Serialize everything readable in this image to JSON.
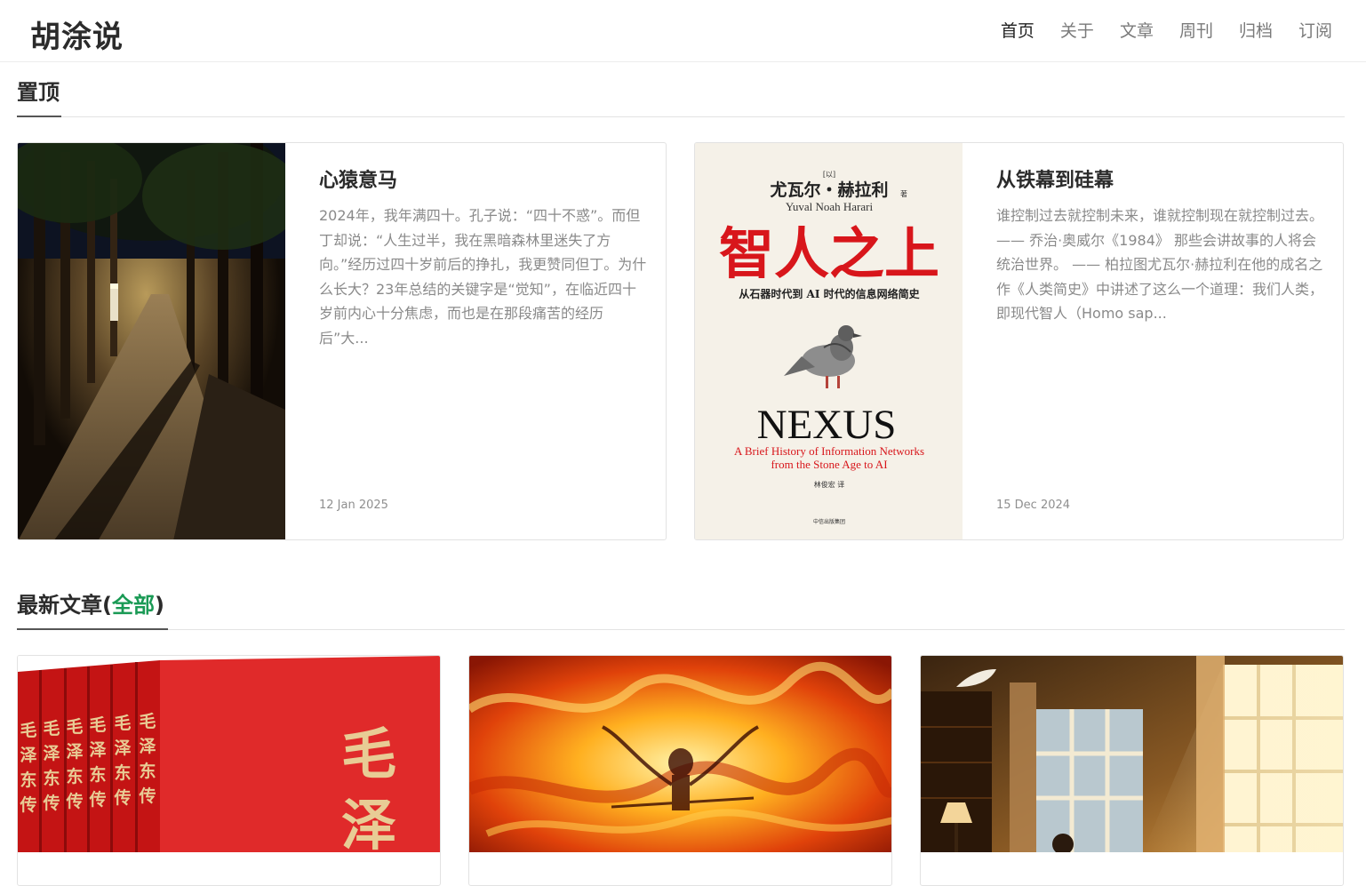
{
  "site": {
    "logo": "胡涂说"
  },
  "nav": {
    "items": [
      {
        "label": "首页",
        "active": true
      },
      {
        "label": "关于",
        "active": false
      },
      {
        "label": "文章",
        "active": false
      },
      {
        "label": "周刊",
        "active": false
      },
      {
        "label": "归档",
        "active": false
      },
      {
        "label": "订阅",
        "active": false
      }
    ]
  },
  "pinned": {
    "title": "置顶",
    "posts": [
      {
        "title": "心猿意马",
        "excerpt": "2024年，我年满四十。孔子说：“四十不惑”。而但丁却说：“人生过半，我在黑暗森林里迷失了方向。”经历过四十岁前后的挣扎，我更赞同但丁。为什么长大？23年总结的关键字是“觉知”，在临近四十岁前内心十分焦虑，而也是在那段痛苦的经历后”大...",
        "date": "12 Jan 2025",
        "image": "night-park-path-photo"
      },
      {
        "title": "从铁幕到硅幕",
        "excerpt": "谁控制过去就控制未来，谁就控制现在就控制过去。 —— 乔治·奥威尔《1984》 那些会讲故事的人将会统治世界。 —— 柏拉图尤瓦尔·赫拉利在他的成名之作《人类简史》中讲述了这么一个道理：我们人类，即现代智人（Homo sap...",
        "date": "15 Dec 2024",
        "image": "nexus-book-cover",
        "cover": {
          "prefix": "[以]",
          "author_cn": "尤瓦尔・赫拉利",
          "author_suffix": "著",
          "author_en": "Yuval Noah Harari",
          "title_cn": "智人之上",
          "subtitle_cn": "从石器时代到 AI 时代的信息网络简史",
          "title_en": "NEXUS",
          "subtitle_en_1": "A Brief History of Information Networks",
          "subtitle_en_2": "from the Stone Age to AI",
          "translator": "林俊宏  译",
          "publisher": "中信出版集团"
        }
      }
    ]
  },
  "latest": {
    "title": "最新文章(",
    "link_label": "全部",
    "title_close": ")",
    "posts": [
      {
        "image": "mao-biography-book-spines",
        "spine_text": "毛泽东传",
        "cover_text": "毛泽"
      },
      {
        "image": "flame-figure-painting"
      },
      {
        "image": "sunlit-window-study-room"
      }
    ]
  },
  "colors": {
    "accent": "#1a9a55",
    "nexus_red": "#d8161b",
    "cover_bg": "#f5f1e8"
  }
}
